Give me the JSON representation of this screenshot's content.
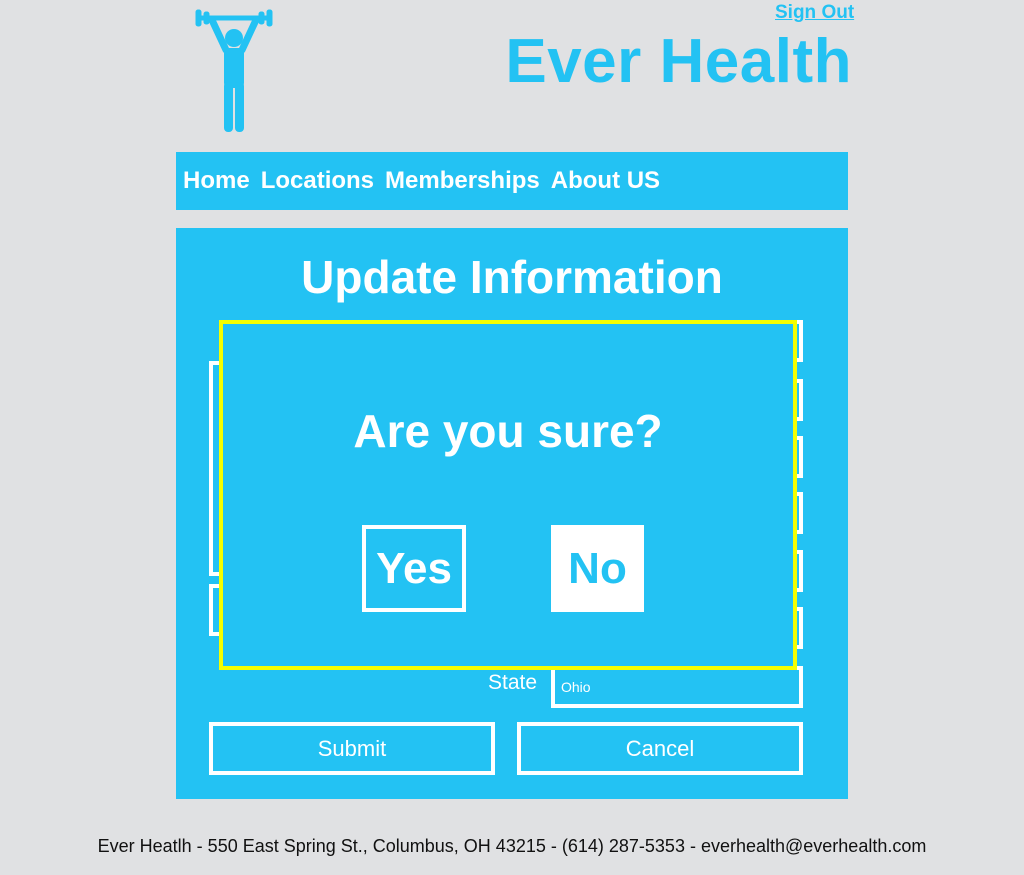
{
  "header": {
    "sign_out": "Sign Out",
    "brand": "Ever Health",
    "logo_icon": "weightlifter-icon"
  },
  "nav": {
    "items": [
      "Home",
      "Locations",
      "Memberships",
      "About US"
    ]
  },
  "form": {
    "title": "Update Information",
    "state_label": "State",
    "state_value": "Ohio",
    "submit_label": "Submit",
    "cancel_label": "Cancel"
  },
  "dialog": {
    "question": "Are you sure?",
    "yes_label": "Yes",
    "no_label": "No"
  },
  "footer": {
    "text": "Ever Heatlh - 550 East Spring St., Columbus, OH 43215 - (614) 287-5353 - everhealth@everhealth.com"
  },
  "colors": {
    "brand": "#23c2f3",
    "background": "#e0e1e3",
    "dialog_border": "#f4ff00",
    "text_on_brand": "#ffffff"
  }
}
